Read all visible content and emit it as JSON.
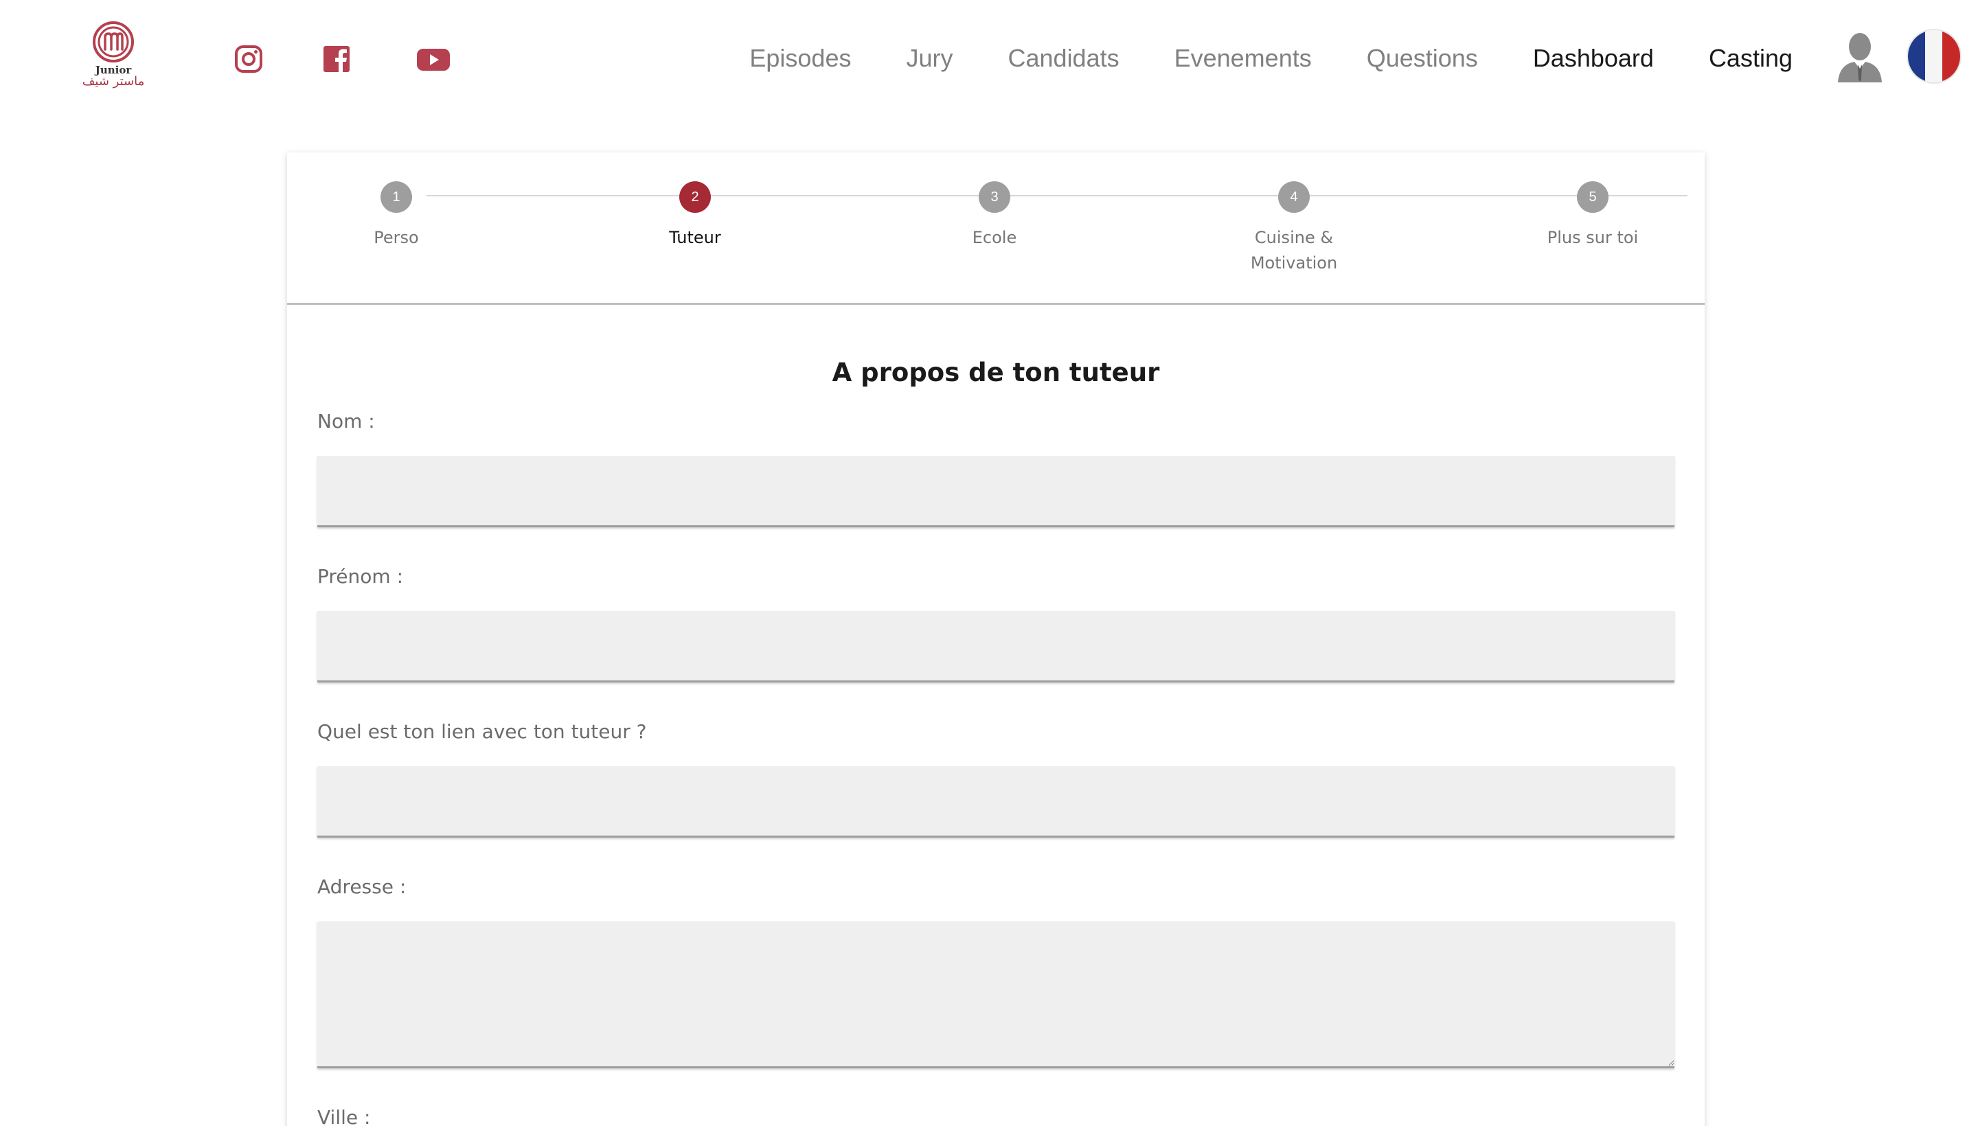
{
  "header": {
    "logo": {
      "line1": "Junior",
      "line2": "ماستر شيف"
    },
    "social": [
      {
        "name": "instagram-icon",
        "color": "#b5404f"
      },
      {
        "name": "facebook-icon",
        "color": "#b5404f"
      },
      {
        "name": "youtube-icon",
        "color": "#b5404f"
      }
    ],
    "nav": {
      "episodes": "Episodes",
      "jury": "Jury",
      "candidats": "Candidats",
      "evenements": "Evenements",
      "questions": "Questions",
      "dashboard": "Dashboard",
      "casting": "Casting"
    },
    "language": "fr"
  },
  "stepper": {
    "active_step": 2,
    "steps": [
      {
        "number": "1",
        "label": "Perso"
      },
      {
        "number": "2",
        "label": "Tuteur"
      },
      {
        "number": "3",
        "label": "Ecole"
      },
      {
        "number": "4",
        "label": "Cuisine & Motivation"
      },
      {
        "number": "5",
        "label": "Plus sur toi"
      }
    ]
  },
  "form": {
    "title": "A propos de ton tuteur",
    "fields": {
      "nom": {
        "label": "Nom :",
        "value": ""
      },
      "prenom": {
        "label": "Prénom :",
        "value": ""
      },
      "lien": {
        "label": "Quel est ton lien avec ton tuteur ?",
        "value": ""
      },
      "adresse": {
        "label": "Adresse :",
        "value": ""
      },
      "ville": {
        "label": "Ville :",
        "value": ""
      }
    }
  },
  "colors": {
    "accent": "#a52a36",
    "step_inactive": "#9e9e9e",
    "nav_text": "#808080",
    "field_bg": "#efefef"
  }
}
